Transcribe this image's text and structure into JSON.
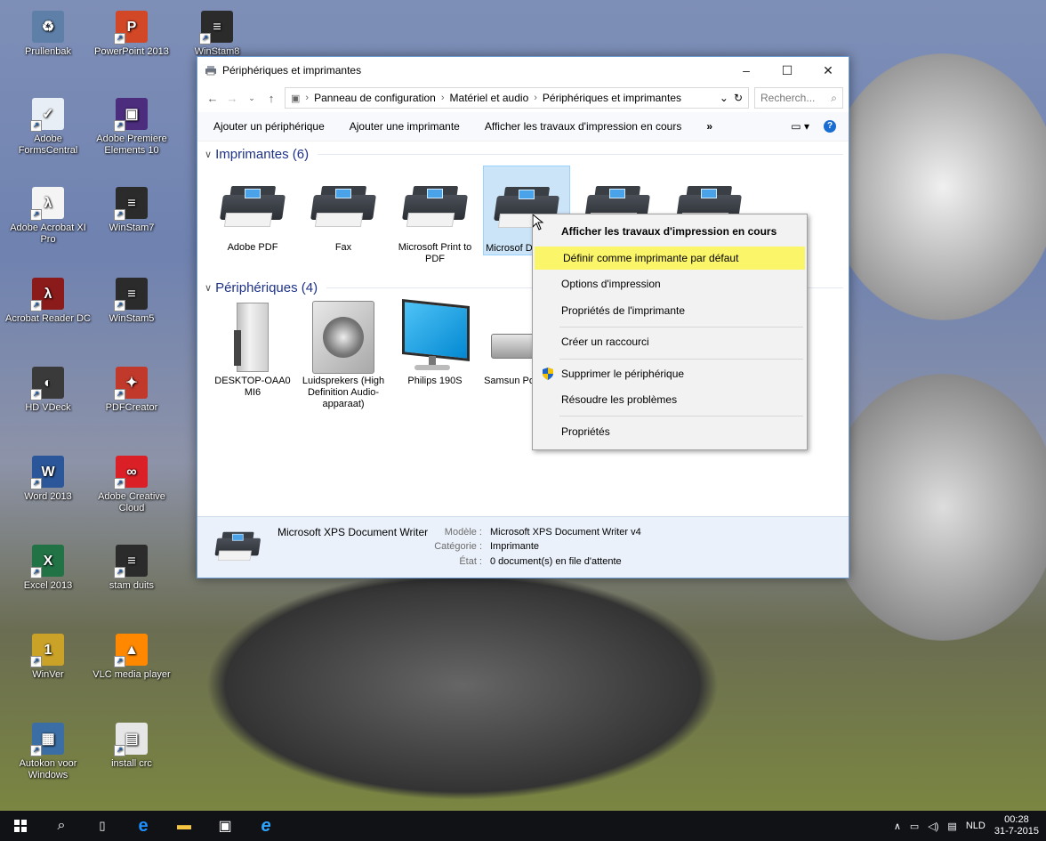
{
  "desktop": {
    "icons": [
      {
        "label": "Prullenbak",
        "color": "#5d7fa8",
        "glyph": "♻"
      },
      {
        "label": "PowerPoint 2013",
        "color": "#d24726",
        "glyph": "P"
      },
      {
        "label": "WinStam8",
        "color": "#2b2b2b",
        "glyph": "≡"
      },
      {
        "label": "Adobe FormsCentral",
        "color": "#e8eef5",
        "glyph": "✓"
      },
      {
        "label": "Adobe Premiere Elements 10",
        "color": "#4b2c7d",
        "glyph": "▣"
      },
      {
        "label": "Adobe Acrobat XI Pro",
        "color": "#f4f4f4",
        "glyph": "λ"
      },
      {
        "label": "WinStam7",
        "color": "#2b2b2b",
        "glyph": "≡"
      },
      {
        "label": "Acrobat Reader DC",
        "color": "#8b1a1a",
        "glyph": "λ"
      },
      {
        "label": "WinStam5",
        "color": "#2b2b2b",
        "glyph": "≡"
      },
      {
        "label": "HD VDeck",
        "color": "#3a3a3a",
        "glyph": "◐"
      },
      {
        "label": "PDFCreator",
        "color": "#c0392b",
        "glyph": "✦"
      },
      {
        "label": "Word 2013",
        "color": "#2b579a",
        "glyph": "W"
      },
      {
        "label": "Adobe Creative Cloud",
        "color": "#da1f26",
        "glyph": "∞"
      },
      {
        "label": "Excel 2013",
        "color": "#217346",
        "glyph": "X"
      },
      {
        "label": "stam duits",
        "color": "#2b2b2b",
        "glyph": "≡"
      },
      {
        "label": "WinVer",
        "color": "#c9a227",
        "glyph": "1"
      },
      {
        "label": "VLC media player",
        "color": "#ff8800",
        "glyph": "▲"
      },
      {
        "label": "Autokon voor Windows",
        "color": "#3a6ea5",
        "glyph": "▦"
      },
      {
        "label": "install crc",
        "color": "#e6e6e6",
        "glyph": "▤"
      }
    ]
  },
  "window": {
    "title": "Périphériques et imprimantes",
    "breadcrumb": [
      "Panneau de configuration",
      "Matériel et audio",
      "Périphériques et imprimantes"
    ],
    "search_placeholder": "Recherch...",
    "commands": [
      "Ajouter un périphérique",
      "Ajouter une imprimante",
      "Afficher les travaux d'impression en cours",
      "»"
    ],
    "printers_header": "Imprimantes (6)",
    "printers": [
      {
        "name": "Adobe PDF"
      },
      {
        "name": "Fax"
      },
      {
        "name": "Microsoft Print to PDF"
      },
      {
        "name": "Microsoft XPS Document Writer",
        "display": "Microsof Documen"
      }
    ],
    "devices_header": "Périphériques (4)",
    "devices": [
      {
        "name": "DESKTOP-OAA0 MI6"
      },
      {
        "name": "Luidsprekers (High Definition Audio-apparaat)"
      },
      {
        "name": "Philips 190S"
      },
      {
        "name": "Samsun Portab"
      }
    ],
    "details": {
      "name": "Microsoft XPS Document Writer",
      "model_label": "Modèle :",
      "model_value": "Microsoft XPS Document Writer v4",
      "category_label": "Catégorie :",
      "category_value": "Imprimante",
      "state_label": "État :",
      "state_value": "0 document(s) en file d'attente"
    }
  },
  "context_menu": {
    "items": [
      "Afficher les travaux d'impression en cours",
      "Définir comme imprimante par défaut",
      "Options d'impression",
      "Propriétés de l'imprimante",
      "Créer un raccourci",
      "Supprimer le périphérique",
      "Résoudre les problèmes",
      "Propriétés"
    ],
    "highlight_color": "#fbf56a"
  },
  "taskbar": {
    "language": "NLD",
    "time": "00:28",
    "date": "31-7-2015"
  }
}
